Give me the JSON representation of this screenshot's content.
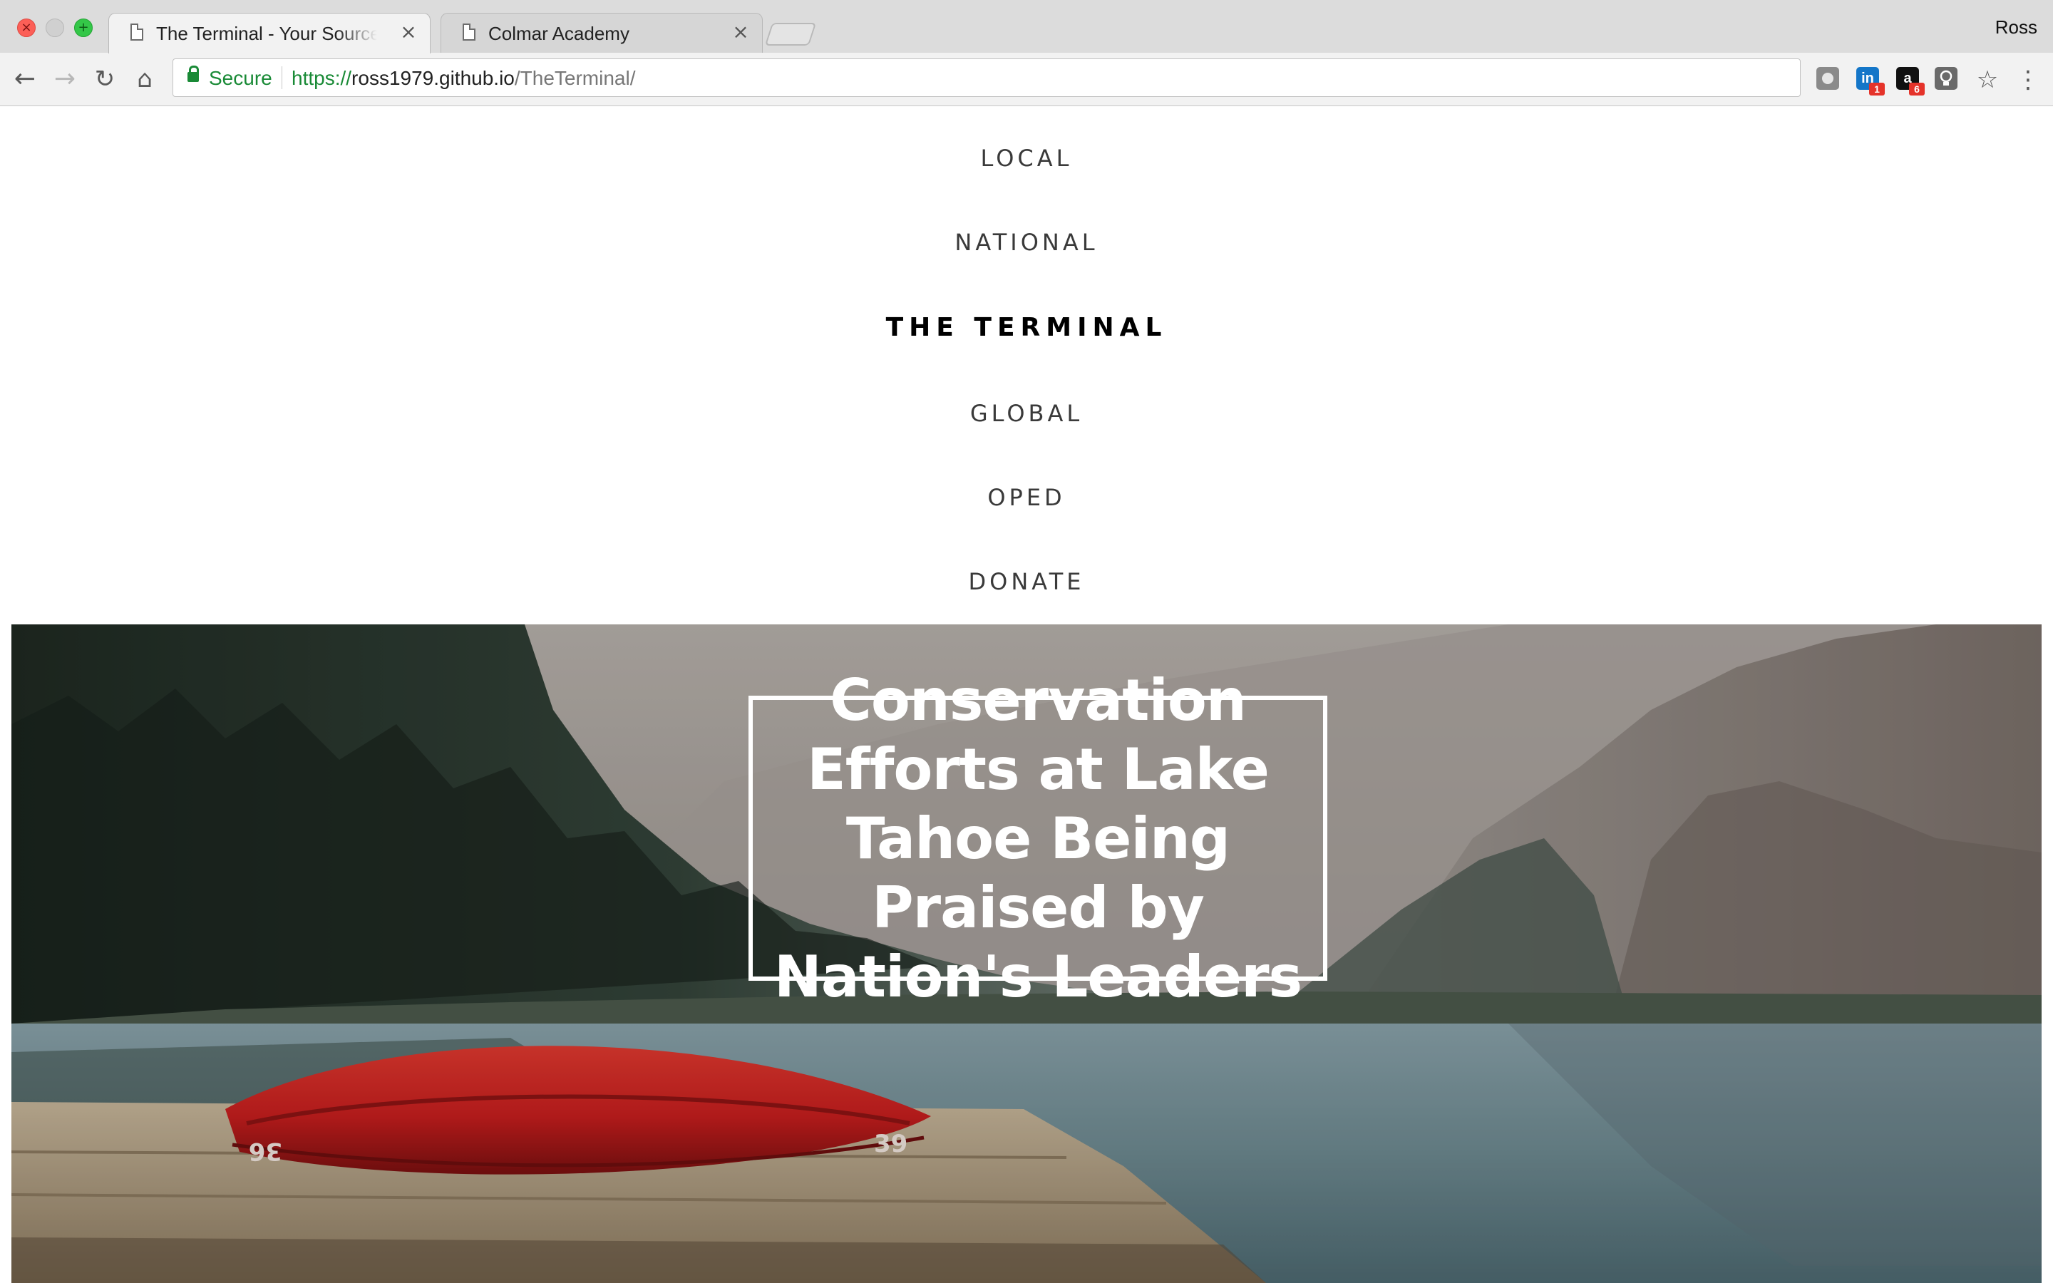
{
  "browser": {
    "tabs": [
      {
        "title": "The Terminal - Your Source for",
        "close": "×"
      },
      {
        "title": "Colmar Academy",
        "close": "×"
      }
    ],
    "profile": "Ross",
    "omnibox": {
      "secure_label": "Secure",
      "url_scheme": "https://",
      "url_host": "ross1979.github.io",
      "url_path": "/TheTerminal/"
    },
    "extensions": {
      "linkedin_label": "in",
      "linkedin_badge": "1",
      "amazon_label": "a",
      "amazon_badge": "6"
    },
    "icons": [
      "back-icon",
      "forward-icon",
      "reload-icon",
      "home-icon",
      "lock-icon",
      "star-icon",
      "menu-icon"
    ]
  },
  "site": {
    "nav": {
      "local": "LOCAL",
      "national": "NATIONAL",
      "brand": "THE TERMINAL",
      "global": "GLOBAL",
      "oped": "OPED",
      "donate": "DONATE"
    },
    "hero": {
      "headline": "Conservation Efforts at Lake Tahoe Being Praised by Nation's Leaders",
      "canoe_left_number": "36",
      "canoe_right_number": "39"
    }
  },
  "colors": {
    "secure_green": "#198a36",
    "canoe_red": "#c81e1e",
    "brand_text": "#000000"
  }
}
